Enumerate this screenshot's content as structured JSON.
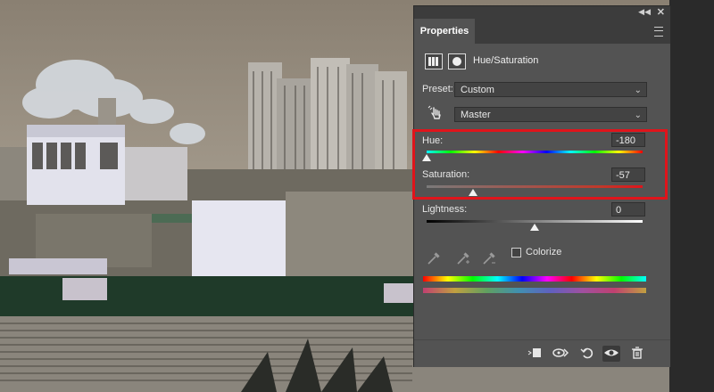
{
  "panel": {
    "tab_label": "Properties",
    "adjustment_title": "Hue/Saturation",
    "preset": {
      "label": "Preset:",
      "value": "Custom"
    },
    "channel": {
      "value": "Master"
    },
    "hue": {
      "label": "Hue:",
      "value": "-180",
      "level": -180,
      "min": -180,
      "max": 180
    },
    "saturation": {
      "label": "Saturation:",
      "value": "-57",
      "level": -57,
      "min": -100,
      "max": 100
    },
    "lightness": {
      "label": "Lightness:",
      "value": "0",
      "level": 0,
      "min": -100,
      "max": 100
    },
    "colorize": {
      "label": "Colorize",
      "checked": false
    },
    "highlight_color": "#e0141b"
  },
  "icons": {
    "collapse": "double-chevron-icon",
    "close": "close-icon",
    "menu": "panel-menu-icon",
    "adjustment": "hue-saturation-adjustment-icon",
    "mask": "layer-mask-icon",
    "targeted_adjust": "targeted-adjustment-hand-icon",
    "eyedroppers": [
      "eyedropper-icon",
      "eyedropper-add-icon",
      "eyedropper-subtract-icon"
    ],
    "footer": [
      "clip-to-layer-icon",
      "view-previous-state-icon",
      "reset-icon",
      "visibility-eye-icon",
      "delete-icon"
    ]
  }
}
